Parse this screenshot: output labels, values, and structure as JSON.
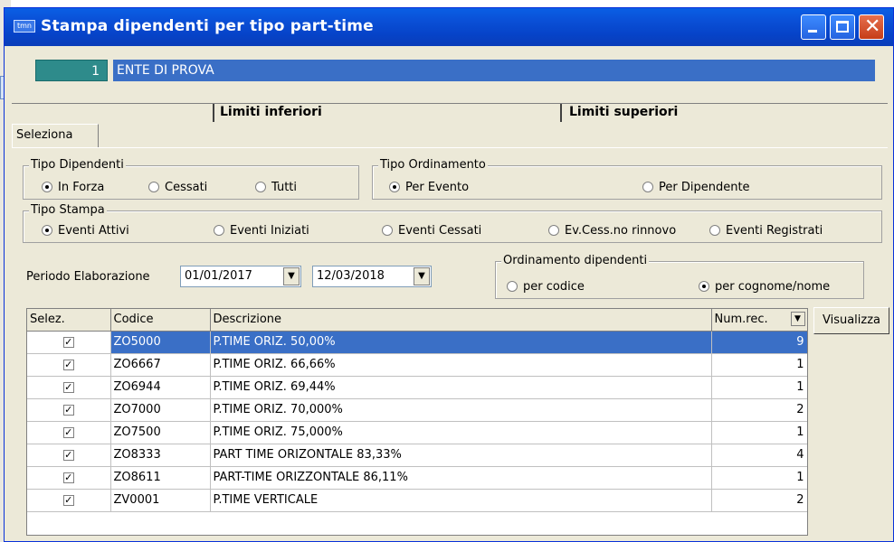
{
  "window": {
    "title": "Stampa dipendenti per tipo part-time",
    "icon_label": "tmn"
  },
  "ente": {
    "code": "1",
    "name": "ENTE DI PROVA"
  },
  "limits": {
    "inferiori": "Limiti inferiori",
    "superiori": "Limiti superiori"
  },
  "tab": {
    "label": "Seleziona"
  },
  "tipo_dipendenti": {
    "legend": "Tipo Dipendenti",
    "options": [
      "In Forza",
      "Cessati",
      "Tutti"
    ],
    "selected": "In Forza"
  },
  "tipo_ordinamento": {
    "legend": "Tipo Ordinamento",
    "options": [
      "Per Evento",
      "Per Dipendente"
    ],
    "selected": "Per Evento"
  },
  "tipo_stampa": {
    "legend": "Tipo Stampa",
    "options": [
      "Eventi Attivi",
      "Eventi Iniziati",
      "Eventi Cessati",
      "Ev.Cess.no rinnovo",
      "Eventi Registrati"
    ],
    "selected": "Eventi Attivi"
  },
  "periodo": {
    "label": "Periodo Elaborazione",
    "from": "01/01/2017",
    "to": "12/03/2018"
  },
  "ordinamento_dipendenti": {
    "legend": "Ordinamento dipendenti",
    "options": [
      "per codice",
      "per cognome/nome"
    ],
    "selected": "per cognome/nome"
  },
  "grid": {
    "columns": [
      "Selez.",
      "Codice",
      "Descrizione",
      "Num.rec."
    ],
    "rows": [
      {
        "checked": true,
        "codice": "ZO5000",
        "descrizione": "P.TIME ORIZ. 50,00%",
        "num": "9"
      },
      {
        "checked": true,
        "codice": "ZO6667",
        "descrizione": "P.TIME ORIZ. 66,66%",
        "num": "1"
      },
      {
        "checked": true,
        "codice": "ZO6944",
        "descrizione": "P.TIME ORIZ. 69,44%",
        "num": "1"
      },
      {
        "checked": true,
        "codice": "ZO7000",
        "descrizione": "P.TIME ORIZ. 70,000%",
        "num": "2"
      },
      {
        "checked": true,
        "codice": "ZO7500",
        "descrizione": "P.TIME ORIZ. 75,000%",
        "num": "1"
      },
      {
        "checked": true,
        "codice": "ZO8333",
        "descrizione": "PART TIME ORIZONTALE 83,33%",
        "num": "4"
      },
      {
        "checked": true,
        "codice": "ZO8611",
        "descrizione": "PART-TIME ORIZZONTALE 86,11%",
        "num": "1"
      },
      {
        "checked": true,
        "codice": "ZV0001",
        "descrizione": "P.TIME VERTICALE",
        "num": "2"
      }
    ]
  },
  "buttons": {
    "visualizza": "Visualizza"
  },
  "icons": {
    "checkbox": "checkmark-icon",
    "dropdown": "chevron-down-icon"
  }
}
